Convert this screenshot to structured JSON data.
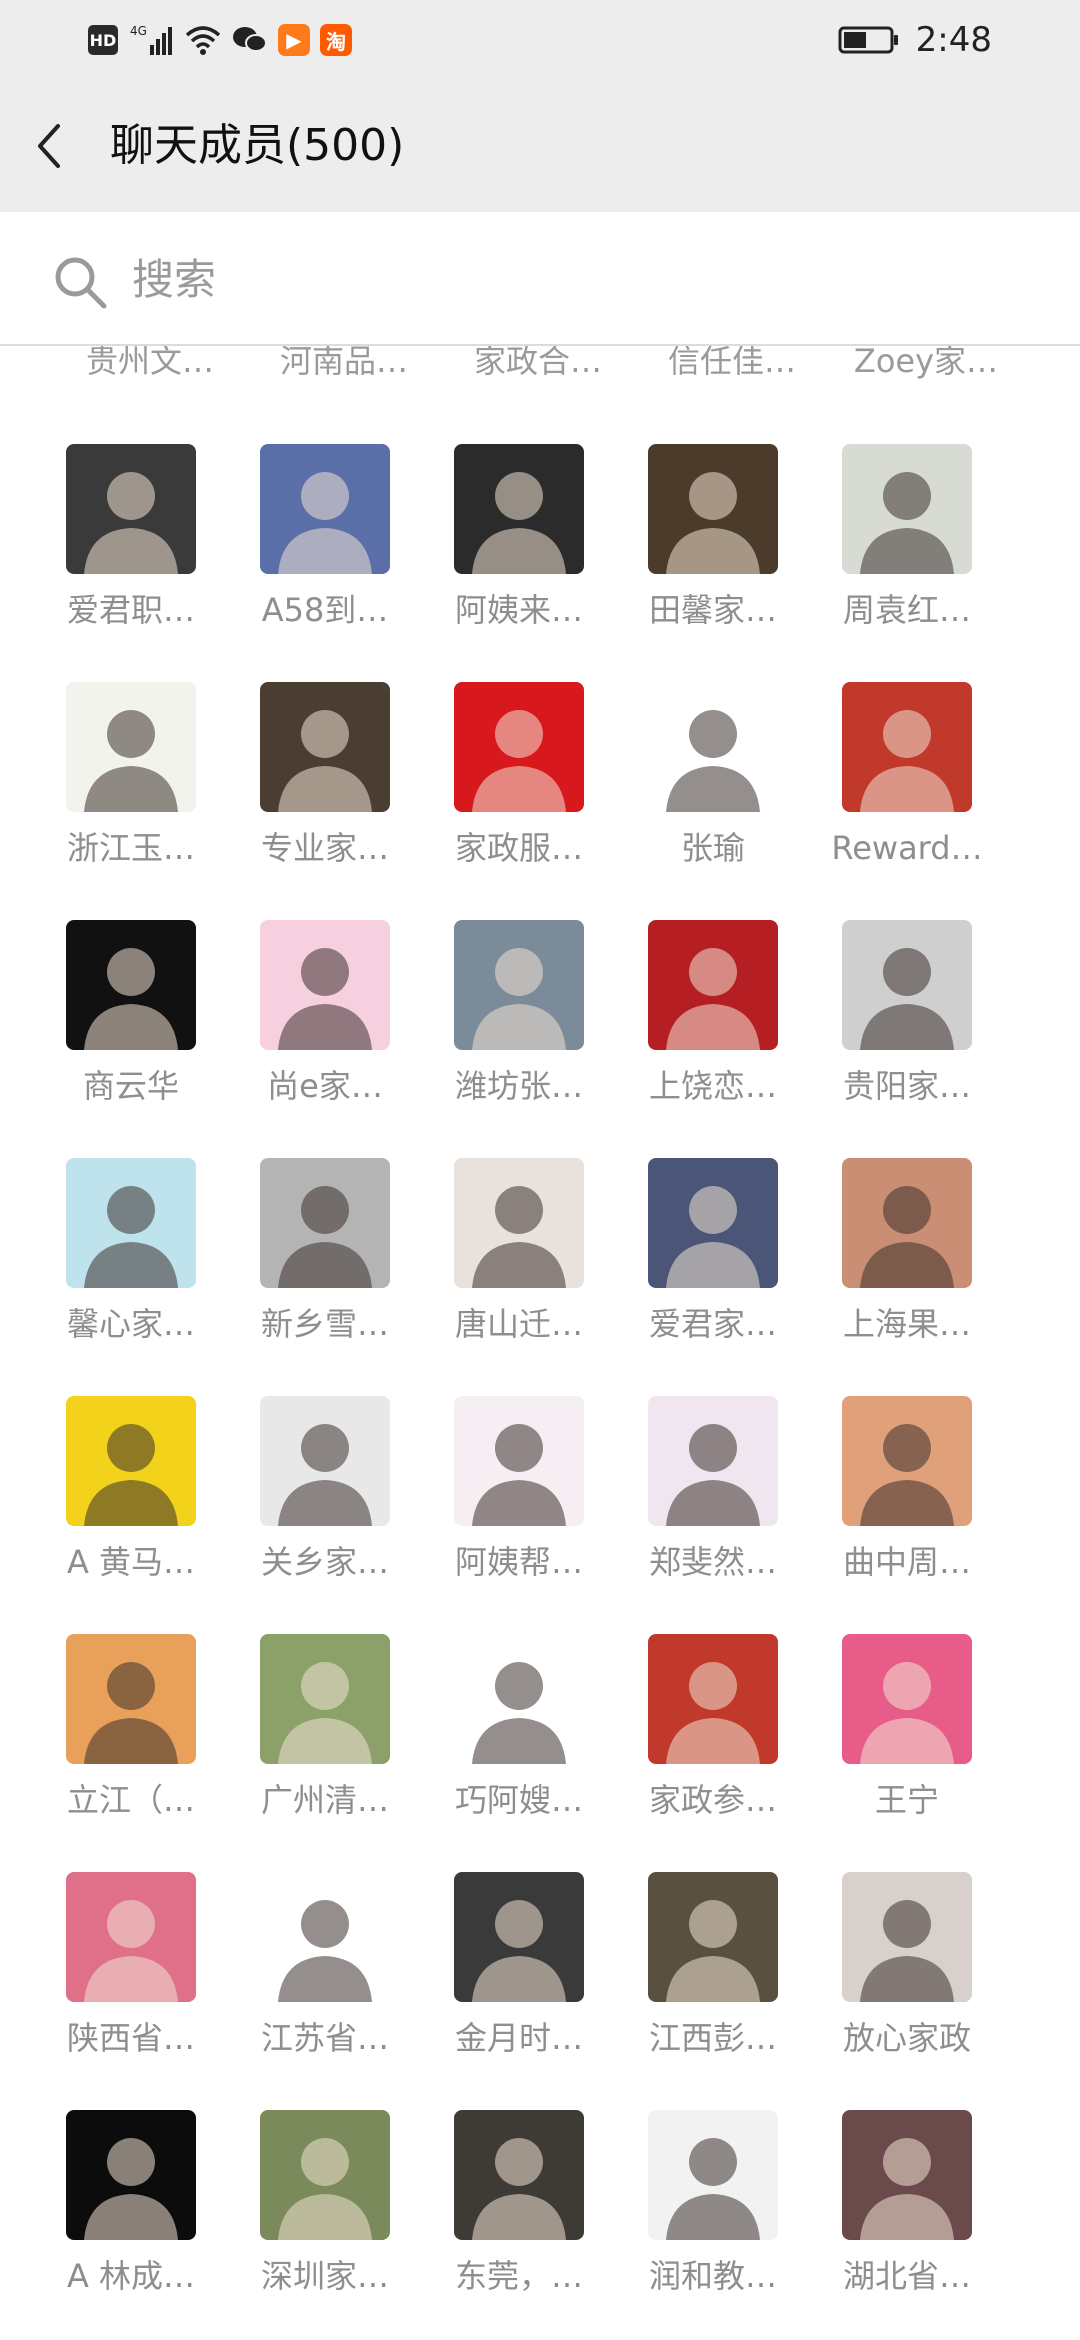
{
  "status_bar": {
    "left_badge": "HD",
    "net_label": "4G",
    "app_badge_1": "▶",
    "app_badge_2": "淘",
    "time": "2:48"
  },
  "header": {
    "title": "聊天成员(500)"
  },
  "search": {
    "placeholder": "搜索",
    "value": ""
  },
  "top_cut_names": [
    "贵州文…",
    "河南品…",
    "家政合…",
    "信任佳…",
    "Zoey家…"
  ],
  "members": [
    {
      "name": "爱君职…",
      "color": "#3a3a3a"
    },
    {
      "name": "A58到…",
      "color": "#5a6ea8"
    },
    {
      "name": "阿姨来…",
      "color": "#2b2b2b"
    },
    {
      "name": "田馨家…",
      "color": "#4b3b2b"
    },
    {
      "name": "周袁红…",
      "color": "#d8dbd4"
    },
    {
      "name": "浙江玉…",
      "color": "#f3f3ee"
    },
    {
      "name": "专业家…",
      "color": "#4a3d32"
    },
    {
      "name": "家政服…",
      "color": "#d7191e"
    },
    {
      "name": "张瑜",
      "color": "#ffffff"
    },
    {
      "name": "Reward…",
      "color": "#c0392b"
    },
    {
      "name": "商云华",
      "color": "#111111"
    },
    {
      "name": "尚e家…",
      "color": "#f7d0e0"
    },
    {
      "name": "潍坊张…",
      "color": "#7c8b9a"
    },
    {
      "name": "上饶恋…",
      "color": "#b51f24"
    },
    {
      "name": "贵阳家…",
      "color": "#cfcfcf"
    },
    {
      "name": "馨心家…",
      "color": "#bfe3ec"
    },
    {
      "name": "新乡雪…",
      "color": "#b4b4b4"
    },
    {
      "name": "唐山迁…",
      "color": "#e9e2dc"
    },
    {
      "name": "爱君家…",
      "color": "#4a5577"
    },
    {
      "name": "上海果…",
      "color": "#c98e73"
    },
    {
      "name": "A 黄马…",
      "color": "#f2d21b"
    },
    {
      "name": "关乡家…",
      "color": "#e8e8e8"
    },
    {
      "name": "阿姨帮…",
      "color": "#f5eef2"
    },
    {
      "name": "郑斐然…",
      "color": "#efe6f0"
    },
    {
      "name": "曲中周…",
      "color": "#e0a07a"
    },
    {
      "name": "立江（…",
      "color": "#e8a05a"
    },
    {
      "name": "广州清…",
      "color": "#8ca06a"
    },
    {
      "name": "巧阿嫂…",
      "color": "#ffffff"
    },
    {
      "name": "家政参…",
      "color": "#c0392b"
    },
    {
      "name": "王宁",
      "color": "#e85c8a"
    },
    {
      "name": "陕西省…",
      "color": "#e0708a"
    },
    {
      "name": "江苏省…",
      "color": "#ffffff"
    },
    {
      "name": "金月时…",
      "color": "#3a3a3a"
    },
    {
      "name": "江西彭…",
      "color": "#5a5040"
    },
    {
      "name": "放心家政",
      "color": "#d8d0cc"
    },
    {
      "name": "A  林成…",
      "color": "#0c0c0c"
    },
    {
      "name": "深圳家…",
      "color": "#7a8a5a"
    },
    {
      "name": "东莞，…",
      "color": "#3e3a36"
    },
    {
      "name": "润和教…",
      "color": "#f2f2f2"
    },
    {
      "name": "湖北省…",
      "color": "#6a4a4a"
    }
  ],
  "icons": {
    "back": "chevron-left-icon",
    "search": "search-icon"
  },
  "colors": {
    "header_bg": "#ededed",
    "name_text": "#8e8e8e",
    "title_text": "#111111"
  }
}
